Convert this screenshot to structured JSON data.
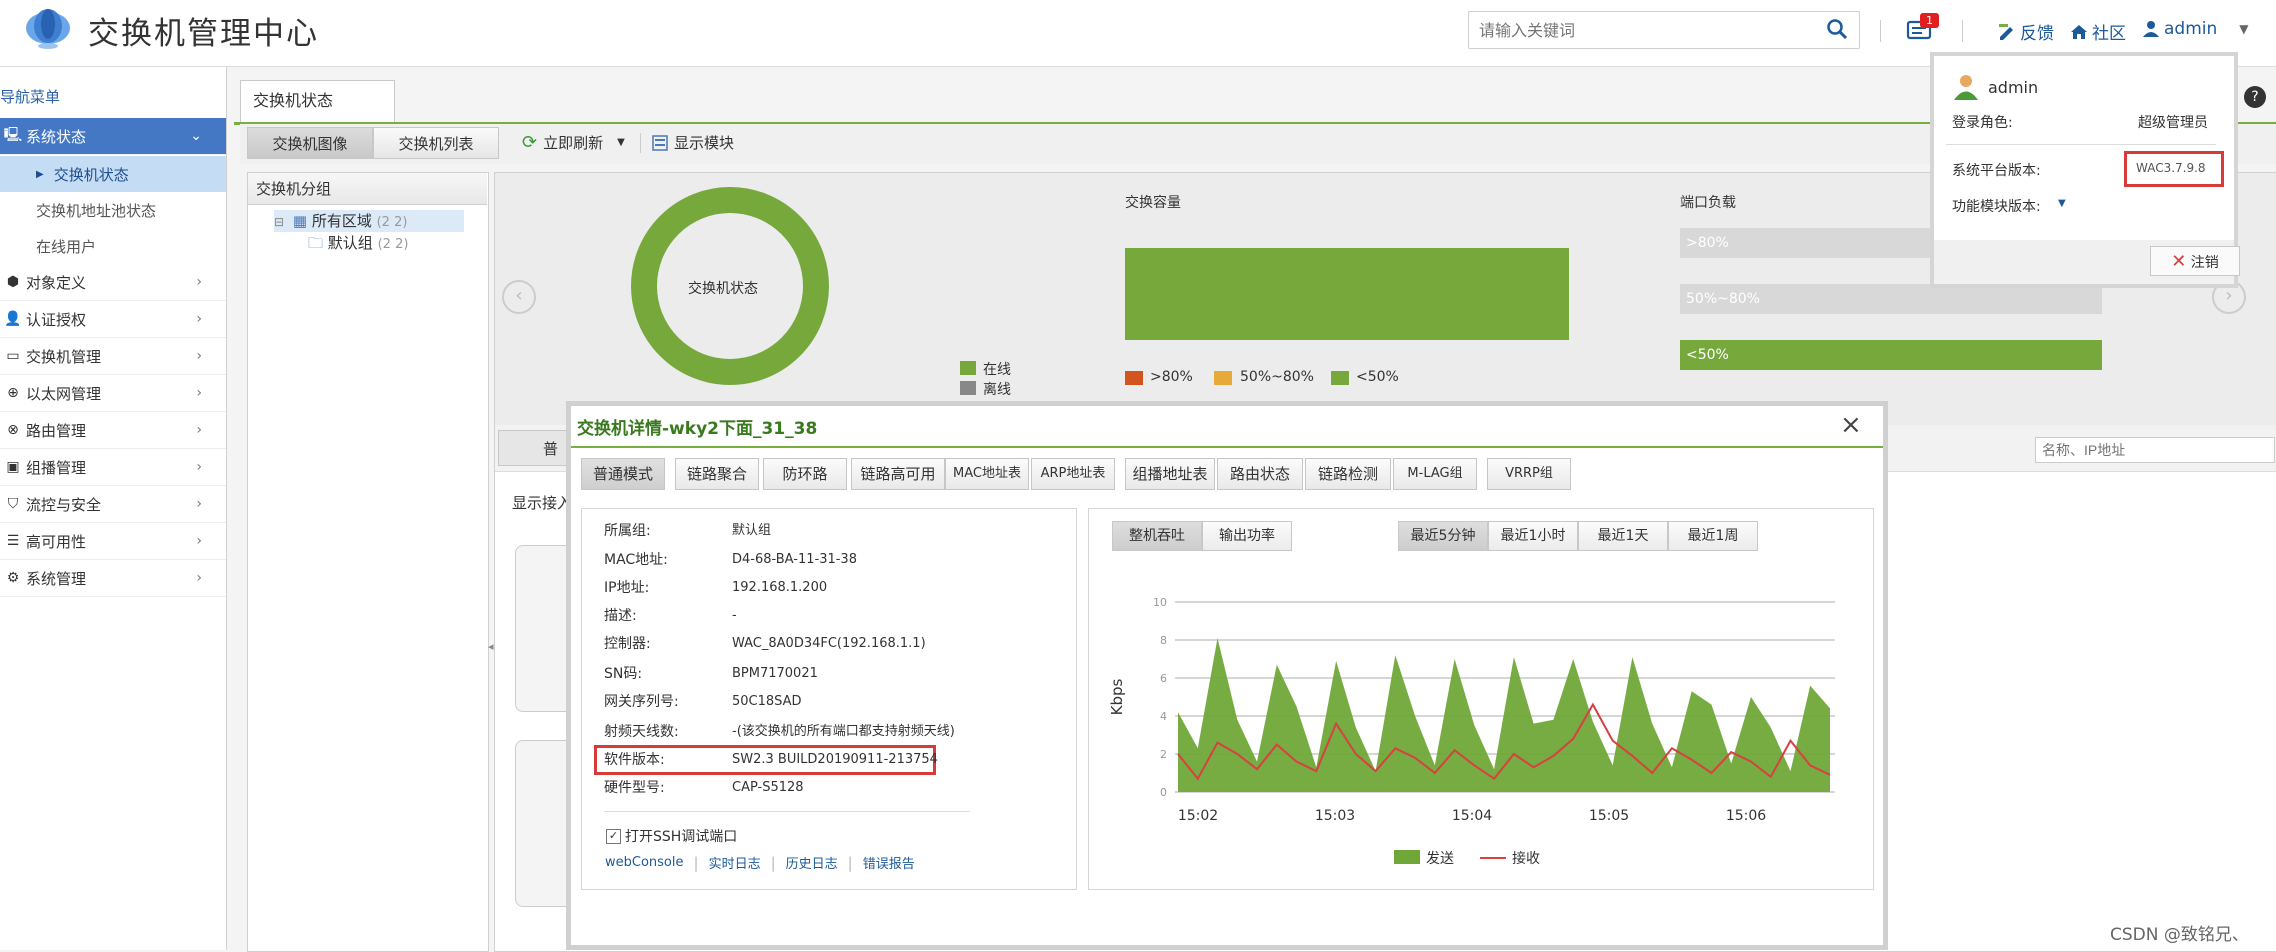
{
  "header": {
    "app_title": "交换机管理中心",
    "search_placeholder": "请输入关键词",
    "notify_count": "1",
    "feedback": "反馈",
    "community": "社区",
    "user": "admin"
  },
  "sidebar": {
    "title": "导航菜单",
    "items": [
      {
        "label": "系统状态",
        "icon": "monitor-icon",
        "expanded": true,
        "children": [
          "交换机状态",
          "交换机地址池状态",
          "在线用户"
        ]
      },
      {
        "label": "对象定义",
        "icon": "cube-icon"
      },
      {
        "label": "认证授权",
        "icon": "user-key-icon"
      },
      {
        "label": "交换机管理",
        "icon": "switch-icon"
      },
      {
        "label": "以太网管理",
        "icon": "globe-icon"
      },
      {
        "label": "路由管理",
        "icon": "router-icon"
      },
      {
        "label": "组播管理",
        "icon": "multicast-icon"
      },
      {
        "label": "流控与安全",
        "icon": "shield-icon"
      },
      {
        "label": "高可用性",
        "icon": "layers-icon"
      },
      {
        "label": "系统管理",
        "icon": "gear-icon"
      }
    ]
  },
  "main": {
    "tab": "交换机状态",
    "toolbar": {
      "view_image": "交换机图像",
      "view_list": "交换机列表",
      "refresh": "立即刷新",
      "show_module": "显示模块"
    },
    "group_panel": {
      "title": "交换机分组",
      "root": "所有区域",
      "root_count": "(2  2)",
      "child": "默认组",
      "child_count": "(2  2)"
    },
    "status": {
      "donut_label": "交换机状态",
      "legend_online": "在线",
      "legend_offline": "离线",
      "capacity_title": "交换容量",
      "cap_legend": [
        ">80%",
        "50%~80%",
        "<50%"
      ],
      "port_title": "端口负载",
      "port_bars": [
        ">80%",
        "50%~80%",
        "<50%"
      ],
      "online_fraction": 1.0,
      "capacity_fraction": 1.0,
      "port_low_fraction": 1.0
    },
    "content_tab_stub": "普通",
    "show_access_stub": "显示接入",
    "search_name_ip_placeholder": "名称、IP地址"
  },
  "user_popup": {
    "name": "admin",
    "role_label": "登录角色:",
    "role_value": "超级管理员",
    "platform_label": "系统平台版本:",
    "platform_value": "WAC3.7.9.8",
    "module_label": "功能模块版本:",
    "logout": "注销"
  },
  "modal": {
    "title": "交换机详情-wky2下面_31_38",
    "tabs": [
      "普通模式",
      "链路聚合",
      "防环路",
      "链路高可用",
      "MAC地址表",
      "ARP地址表",
      "组播地址表",
      "路由状态",
      "链路检测",
      "M-LAG组",
      "VRRP组"
    ],
    "info": [
      {
        "label": "所属组:",
        "value": "默认组"
      },
      {
        "label": "MAC地址:",
        "value": "D4-68-BA-11-31-38"
      },
      {
        "label": "IP地址:",
        "value": "192.168.1.200"
      },
      {
        "label": "描述:",
        "value": "-"
      },
      {
        "label": "控制器:",
        "value": "WAC_8A0D34FC(192.168.1.1)"
      },
      {
        "label": "SN码:",
        "value": "BPM7170021"
      },
      {
        "label": "网关序列号:",
        "value": "50C18SAD"
      },
      {
        "label": "射频天线数:",
        "value": "-(该交换机的所有端口都支持射频天线)"
      },
      {
        "label": "软件版本:",
        "value": "SW2.3 BUILD20190911-213754"
      },
      {
        "label": "硬件型号:",
        "value": "CAP-S5128"
      }
    ],
    "ssh_label": "打开SSH调试端口",
    "links": [
      "webConsole",
      "实时日志",
      "历史日志",
      "错误报告"
    ],
    "graph_tabs": [
      "整机吞吐",
      "输出功率"
    ],
    "time_tabs": [
      "最近5分钟",
      "最近1小时",
      "最近1天",
      "最近1周"
    ],
    "legend_send": "发送",
    "legend_recv": "接收"
  },
  "chart_data": {
    "type": "area",
    "ylabel": "Kbps",
    "ylim": [
      0,
      10
    ],
    "yticks": [
      "0",
      "2",
      "4",
      "6",
      "8",
      "10"
    ],
    "xticks": [
      "15:02",
      "15:03",
      "15:04",
      "15:05",
      "15:06"
    ],
    "series": [
      {
        "name": "发送",
        "color": "#6fa838",
        "values": [
          4.2,
          2.3,
          8.1,
          3.8,
          1.6,
          6.7,
          4.5,
          1.3,
          6.9,
          3.4,
          1.1,
          7.2,
          4.0,
          1.4,
          7.0,
          3.5,
          1.2,
          7.1,
          3.6,
          3.8,
          7.0,
          3.7,
          1.4,
          7.1,
          3.6,
          1.3,
          5.3,
          4.6,
          1.5,
          5.0,
          3.4,
          1.1,
          5.6,
          4.4
        ]
      },
      {
        "name": "接收",
        "color": "#d94040",
        "values": [
          2.0,
          0.7,
          2.6,
          2.0,
          1.2,
          2.5,
          1.6,
          1.1,
          3.6,
          2.0,
          1.1,
          2.3,
          1.8,
          1.0,
          2.2,
          1.4,
          0.7,
          2.0,
          1.3,
          1.9,
          2.8,
          4.6,
          2.7,
          1.9,
          1.0,
          2.3,
          1.7,
          1.0,
          2.1,
          1.6,
          0.8,
          2.7,
          1.4,
          0.9
        ]
      }
    ],
    "grid": true,
    "legend": "bottom"
  },
  "watermark": "CSDN @致铭兄、",
  "colors": {
    "accent_green": "#78b040",
    "nav_active": "#4478c4",
    "highlight_red": "#d83a3a",
    "link_blue": "#1c5a9c"
  }
}
